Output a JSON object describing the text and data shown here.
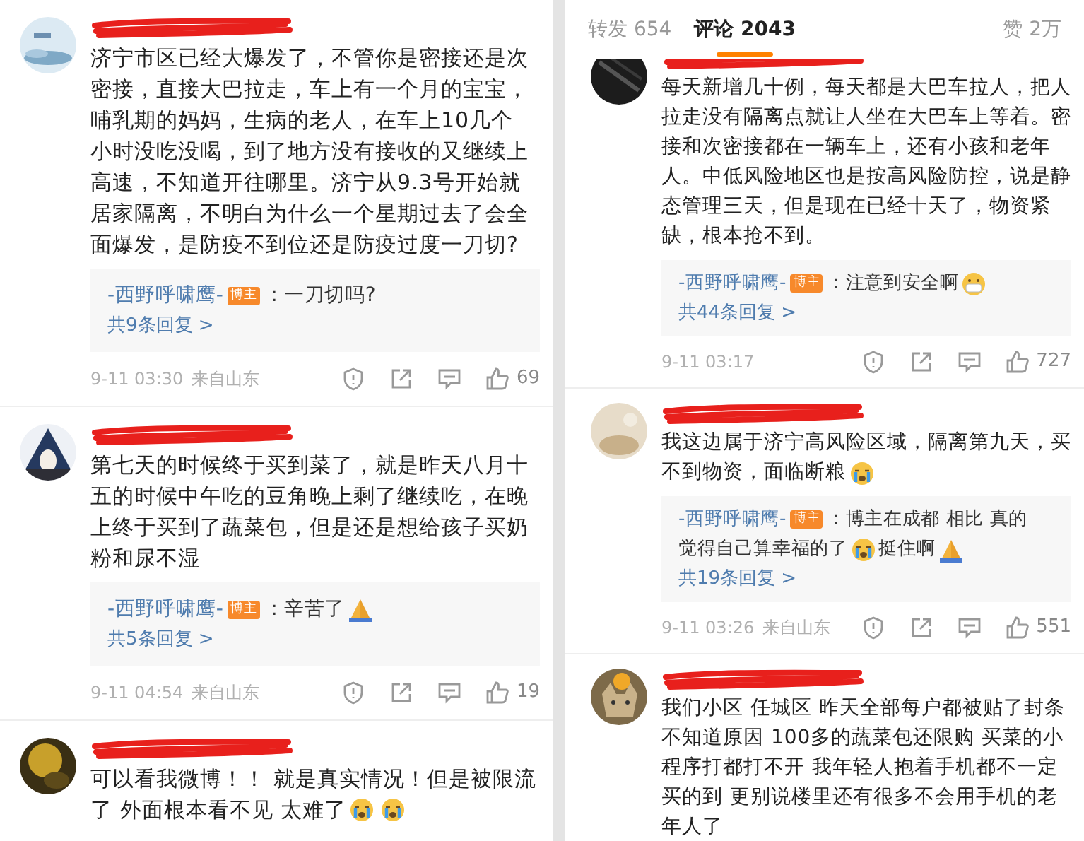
{
  "panels": [
    {
      "comments": [
        {
          "lines": [
            [
              {
                "kind": "text",
                "text": "济宁市区已经大爆发了，不管你是密接还是次"
              }
            ],
            [
              {
                "kind": "text",
                "text": "密接，直接大巴拉走，车上有一个月的宝宝，"
              }
            ],
            [
              {
                "kind": "text",
                "text": "哺乳期的妈妈，生病的老人，在车上10几个"
              }
            ],
            [
              {
                "kind": "text",
                "text": "小时没吃没喝，到了地方没有接收的又继续上"
              }
            ],
            [
              {
                "kind": "text",
                "text": "高速，不知道开往哪里。济宁从9.3号开始就"
              }
            ],
            [
              {
                "kind": "text",
                "text": "居家隔离，不明白为什么一个星期过去了会全"
              }
            ],
            [
              {
                "kind": "text",
                "text": "面爆发，是防疫不到位还是防疫过度一刀切?"
              }
            ]
          ],
          "reply": [
            [
              {
                "kind": "author",
                "text": "-西野呼啸鹰-"
              },
              {
                "kind": "badge",
                "text": "博主"
              },
              {
                "kind": "text",
                "text": "：一刀切吗?"
              }
            ]
          ],
          "more": "共9条回复 >",
          "time": "9-11 03:30",
          "location": "来自山东",
          "likes": "69"
        },
        {
          "lines": [
            [
              {
                "kind": "text",
                "text": "第七天的时候终于买到菜了，就是昨天八月十"
              }
            ],
            [
              {
                "kind": "text",
                "text": "五的时候中午吃的豆角晚上剩了继续吃，在晚"
              }
            ],
            [
              {
                "kind": "text",
                "text": "上终于买到了蔬菜包，但是还是想给孩子买奶"
              }
            ],
            [
              {
                "kind": "text",
                "text": "粉和尿不湿"
              }
            ]
          ],
          "reply": [
            [
              {
                "kind": "author",
                "text": "-西野呼啸鹰-"
              },
              {
                "kind": "badge",
                "text": "博主"
              },
              {
                "kind": "text",
                "text": "：辛苦了"
              },
              {
                "kind": "pray"
              }
            ]
          ],
          "more": "共5条回复 >",
          "time": "9-11 04:54",
          "location": "来自山东",
          "likes": "19"
        },
        {
          "lines": [
            [
              {
                "kind": "text",
                "text": "可以看我微博！！ 就是真实情况！但是被限流"
              }
            ],
            [
              {
                "kind": "text",
                "text": "了 外面根本看不见 太难了"
              },
              {
                "kind": "cry"
              },
              {
                "kind": "cry"
              }
            ]
          ]
        }
      ]
    },
    {
      "tabs": [
        {
          "label": "转发 654",
          "selected": false
        },
        {
          "label": "评论 2043",
          "selected": true
        }
      ],
      "praise": "赞 2万",
      "comments": [
        {
          "lines": [
            [
              {
                "kind": "text",
                "text": "每天新增几十例，每天都是大巴车拉人，把人"
              }
            ],
            [
              {
                "kind": "text",
                "text": "拉走没有隔离点就让人坐在大巴车上等着。密"
              }
            ],
            [
              {
                "kind": "text",
                "text": "接和次密接都在一辆车上，还有小孩和老年"
              }
            ],
            [
              {
                "kind": "text",
                "text": "人。中低风险地区也是按高风险防控，说是静"
              }
            ],
            [
              {
                "kind": "text",
                "text": "态管理三天，但是现在已经十天了，物资紧"
              }
            ],
            [
              {
                "kind": "text",
                "text": "缺，根本抢不到。"
              }
            ]
          ],
          "reply": [
            [
              {
                "kind": "author",
                "text": "-西野呼啸鹰-"
              },
              {
                "kind": "badge",
                "text": "博主"
              },
              {
                "kind": "text",
                "text": "：注意到安全啊"
              },
              {
                "kind": "mask"
              }
            ]
          ],
          "more": "共44条回复 >",
          "time": "9-11 03:17",
          "likes": "727"
        },
        {
          "lines": [
            [
              {
                "kind": "text",
                "text": "我这边属于济宁高风险区域，隔离第九天，买"
              }
            ],
            [
              {
                "kind": "text",
                "text": "不到物资，面临断粮"
              },
              {
                "kind": "cry"
              }
            ]
          ],
          "reply": [
            [
              {
                "kind": "author",
                "text": "-西野呼啸鹰-"
              },
              {
                "kind": "badge",
                "text": "博主"
              },
              {
                "kind": "text",
                "text": "：博主在成都 相比 真的"
              }
            ],
            [
              {
                "kind": "text",
                "text": "觉得自己算幸福的了"
              },
              {
                "kind": "cry"
              },
              {
                "kind": "text",
                "text": "挺住啊"
              },
              {
                "kind": "pray"
              }
            ]
          ],
          "more": "共19条回复 >",
          "time": "9-11 03:26",
          "location": "来自山东",
          "likes": "551"
        },
        {
          "lines": [
            [
              {
                "kind": "text",
                "text": "我们小区 任城区 昨天全部每户都被贴了封条"
              }
            ],
            [
              {
                "kind": "text",
                "text": "不知道原因 100多的蔬菜包还限购 买菜的小"
              }
            ],
            [
              {
                "kind": "text",
                "text": "程序打都打不开 我年轻人抱着手机都不一定"
              }
            ],
            [
              {
                "kind": "text",
                "text": "买的到 更别说楼里还有很多不会用手机的老"
              }
            ],
            [
              {
                "kind": "text",
                "text": "年人了"
              }
            ]
          ]
        }
      ]
    }
  ]
}
